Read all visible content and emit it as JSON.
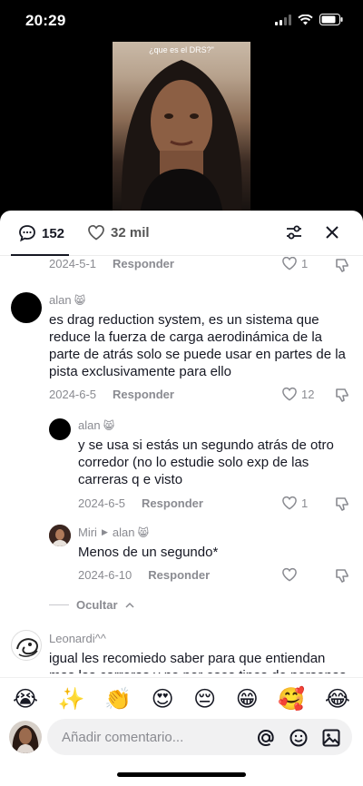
{
  "status": {
    "time": "20:29"
  },
  "video": {
    "caption": "¿que es el DRS?\""
  },
  "header": {
    "comment_count": "152",
    "like_count": "32 mil"
  },
  "comments": [
    {
      "date": "2024-5-1",
      "reply_label": "Responder",
      "likes": "1"
    },
    {
      "username": "alan",
      "badge": "😸",
      "text": "es drag reduction system, es un sistema que reduce la fuerza de carga aerodinámica de la parte de atrás solo se puede usar en partes de la pista exclusivamente para ello",
      "date": "2024-6-5",
      "reply_label": "Responder",
      "likes": "12"
    },
    {
      "username": "alan",
      "badge": "😸",
      "text": "y se usa si estás un segundo atrás de otro corredor (no lo estudie solo exp de las carreras q e visto",
      "date": "2024-6-5",
      "reply_label": "Responder",
      "likes": "1"
    },
    {
      "username": "Miri",
      "reply_to": "alan",
      "badge": "😸",
      "text": "Menos de un segundo*",
      "date": "2024-6-10",
      "reply_label": "Responder"
    },
    {
      "hide_label": "Ocultar"
    },
    {
      "username": "Leonardi^^",
      "text": "igual les recomiedo saber para que entiendan mas las carreras y no por esos tipos de personas"
    }
  ],
  "emoji_bar": [
    "😭",
    "✨",
    "👏",
    "😍",
    "😔",
    "😁",
    "🥰",
    "😂"
  ],
  "input": {
    "placeholder": "Añadir comentario..."
  },
  "icons": [
    "speech-bubble",
    "heart",
    "sliders",
    "close",
    "heart",
    "dislike",
    "at",
    "emoji",
    "image"
  ]
}
